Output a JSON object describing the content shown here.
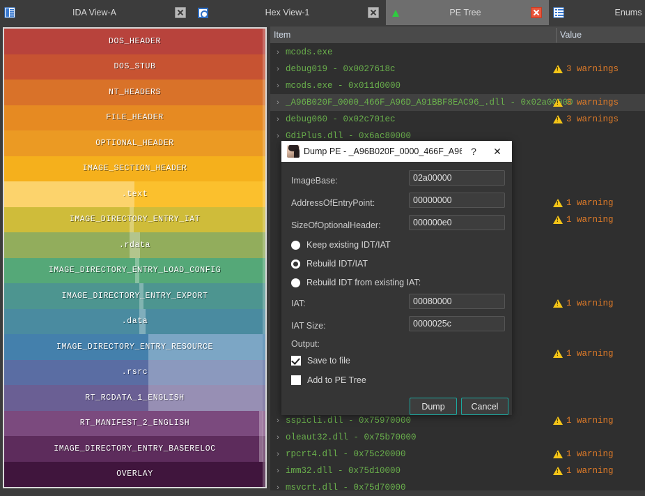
{
  "window": {
    "tabs": [
      {
        "label": "IDA View-A",
        "icon": "document-icon",
        "active": false,
        "closable": true,
        "close_style": "grey"
      },
      {
        "label": "Hex View-1",
        "icon": "hex-view-icon",
        "active": false,
        "closable": true,
        "close_style": "grey"
      },
      {
        "label": "PE Tree",
        "icon": "pe-tree-icon",
        "active": true,
        "closable": true,
        "close_style": "red"
      },
      {
        "label": "Enums",
        "icon": "enums-icon",
        "active": false,
        "closable": true,
        "close_style": "grey"
      },
      {
        "label": "",
        "icon": "structures-icon",
        "active": false,
        "closable": false,
        "close_style": "grey"
      }
    ]
  },
  "map": {
    "rows": [
      {
        "label": "DOS_HEADER",
        "color": "#b8433c"
      },
      {
        "label": "DOS_STUB",
        "color": "#c75332"
      },
      {
        "label": "NT_HEADERS",
        "color": "#d97229"
      },
      {
        "label": "FILE_HEADER",
        "color": "#e68a22"
      },
      {
        "label": "OPTIONAL_HEADER",
        "color": "#eb9a23"
      },
      {
        "label": "IMAGE_SECTION_HEADER",
        "color": "#f5b01c"
      },
      {
        "label": ".text",
        "color": "#fbc02d"
      },
      {
        "label": "IMAGE_DIRECTORY_ENTRY_IAT",
        "color": "#cfbc3a"
      },
      {
        "label": ".rdata",
        "color": "#92ad5c"
      },
      {
        "label": "IMAGE_DIRECTORY_ENTRY_LOAD_CONFIG",
        "color": "#55a878"
      },
      {
        "label": "IMAGE_DIRECTORY_ENTRY_EXPORT",
        "color": "#4d9590"
      },
      {
        "label": ".data",
        "color": "#4a8ba0"
      },
      {
        "label": "IMAGE_DIRECTORY_ENTRY_RESOURCE",
        "color": "#4480ac"
      },
      {
        "label": ".rsrc",
        "color": "#5a6da3"
      },
      {
        "label": "RT_RCDATA_1_ENGLISH",
        "color": "#6a5f94"
      },
      {
        "label": "RT_MANIFEST_2_ENGLISH",
        "color": "#7b4a7e"
      },
      {
        "label": "IMAGE_DIRECTORY_ENTRY_BASERELOC",
        "color": "#5d2c5c"
      },
      {
        "label": "OVERLAY",
        "color": "#40153d"
      }
    ]
  },
  "tree": {
    "columns": [
      "Item",
      "Value"
    ],
    "rows": [
      {
        "item": "mcods.exe",
        "value": "",
        "selected": false
      },
      {
        "item": "debug019 - 0x0027618c",
        "value": "3 warnings",
        "selected": false
      },
      {
        "item": "mcods.exe - 0x011d0000",
        "value": "",
        "selected": false
      },
      {
        "item": "_A96B020F_0000_466F_A96D_A91BBF8EAC96_.dll - 0x02a00000",
        "value": "3 warnings",
        "selected": true
      },
      {
        "item": "debug060 - 0x02c701ec",
        "value": "3 warnings",
        "selected": false
      },
      {
        "item": "GdiPlus.dll - 0x6ac80000",
        "value": "",
        "selected": false
      },
      {
        "item": "",
        "value": "",
        "selected": false
      },
      {
        "item": "",
        "value": "",
        "selected": false
      },
      {
        "item": "",
        "value": "",
        "selected": false
      },
      {
        "item": "",
        "value": "1 warning",
        "selected": false
      },
      {
        "item": "",
        "value": "1 warning",
        "selected": false
      },
      {
        "item": "",
        "value": "",
        "selected": false
      },
      {
        "item": "",
        "value": "",
        "selected": false
      },
      {
        "item": "",
        "value": "",
        "selected": false
      },
      {
        "item": "",
        "value": "",
        "selected": false
      },
      {
        "item": "",
        "value": "1 warning",
        "selected": false
      },
      {
        "item": "",
        "value": "",
        "selected": false
      },
      {
        "item": "",
        "value": "",
        "selected": false
      },
      {
        "item": "",
        "value": "1 warning",
        "selected": false
      },
      {
        "item": "",
        "value": "",
        "selected": false
      },
      {
        "item": "",
        "value": "",
        "selected": false
      },
      {
        "item": "",
        "value": "",
        "selected": false
      },
      {
        "item": "sspicli.dll - 0x75970000",
        "value": "1 warning",
        "selected": false
      },
      {
        "item": "oleaut32.dll - 0x75b70000",
        "value": "",
        "selected": false
      },
      {
        "item": "rpcrt4.dll - 0x75c20000",
        "value": "1 warning",
        "selected": false
      },
      {
        "item": "imm32.dll - 0x75d10000",
        "value": "1 warning",
        "selected": false
      },
      {
        "item": "msvcrt.dll - 0x75d70000",
        "value": "",
        "selected": false
      }
    ],
    "expand_arrow": "›",
    "warning_icon": "warning-triangle-icon"
  },
  "dialog": {
    "title": "Dump PE - _A96B020F_0000_466F_A96...",
    "icon": "app-avatar-icon",
    "help_label": "?",
    "close_label": "✕",
    "fields": [
      {
        "label": "ImageBase:",
        "value": "02a00000"
      },
      {
        "label": "AddressOfEntryPoint:",
        "value": "00000000"
      },
      {
        "label": "SizeOfOptionalHeader:",
        "value": "000000e0"
      }
    ],
    "radios": [
      {
        "label": "Keep existing IDT/IAT",
        "selected": false
      },
      {
        "label": "Rebuild IDT/IAT",
        "selected": true
      },
      {
        "label": "Rebuild IDT from existing IAT:",
        "selected": false
      }
    ],
    "iat": {
      "label": "IAT:",
      "value": "00080000"
    },
    "iat_size": {
      "label": "IAT Size:",
      "value": "0000025c"
    },
    "output_label": "Output:",
    "checkboxes": [
      {
        "label": "Save to file",
        "checked": true
      },
      {
        "label": "Add to PE Tree",
        "checked": false
      }
    ],
    "buttons": {
      "dump": "Dump",
      "cancel": "Cancel"
    }
  }
}
